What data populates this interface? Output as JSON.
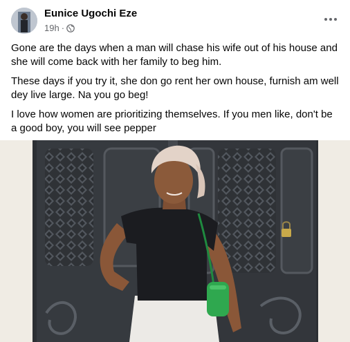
{
  "post": {
    "author_name": "Eunice Ugochi Eze",
    "timestamp": "19h",
    "separator": "·",
    "privacy_icon": "globe-icon",
    "more_icon": "more-options-icon",
    "paragraphs": [
      "Gone are the days when a man will chase his wife out of his house and she will come back with her family to beg him.",
      "These days if you try it, she don go rent her own house, furnish am well dey live large. Na you go beg!",
      "I love how women are prioritizing themselves. If you men like, don't be a good boy, you will see pepper"
    ]
  },
  "colors": {
    "text": "#050505",
    "secondary_text": "#65676b",
    "gate": "#3a3d41",
    "shirt": "#1b1c20",
    "bag": "#2fa84f"
  }
}
